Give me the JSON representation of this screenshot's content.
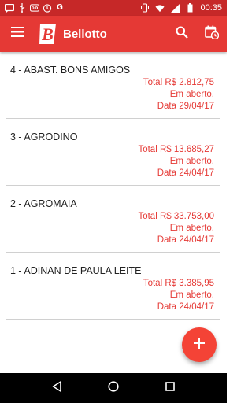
{
  "status_bar": {
    "time": "00:35",
    "left_icons": [
      "sms-icon",
      "usb-icon",
      "voicemail-icon",
      "clock-icon",
      "g-icon"
    ],
    "right_icons": [
      "vibrate-icon",
      "wifi-icon",
      "signal-icon",
      "battery-icon"
    ]
  },
  "app_bar": {
    "title": "Bellotto",
    "logo_letter": "B",
    "icons": [
      "menu-icon",
      "search-icon",
      "calendar-clock-icon"
    ]
  },
  "orders": [
    {
      "name": "4 - ABAST. BONS AMIGOS",
      "total": "Total R$ 2.812,75",
      "status": "Em aberto.",
      "date": "Data 29/04/17"
    },
    {
      "name": "3 - AGRODINO",
      "total": "Total R$ 13.685,27",
      "status": "Em aberto.",
      "date": "Data 24/04/17"
    },
    {
      "name": "2 - AGROMAIA",
      "total": "Total R$ 33.753,00",
      "status": "Em aberto.",
      "date": "Data 24/04/17"
    },
    {
      "name": "1 - ADINAN DE PAULA LEITE",
      "total": "Total R$ 3.385,95",
      "status": "Em aberto.",
      "date": "Data 24/04/17"
    }
  ],
  "fab": {
    "label": "+"
  },
  "colors": {
    "status_bar": "#c62828",
    "app_bar": "#e53935",
    "accent_text": "#e53935",
    "fab": "#f44336"
  }
}
